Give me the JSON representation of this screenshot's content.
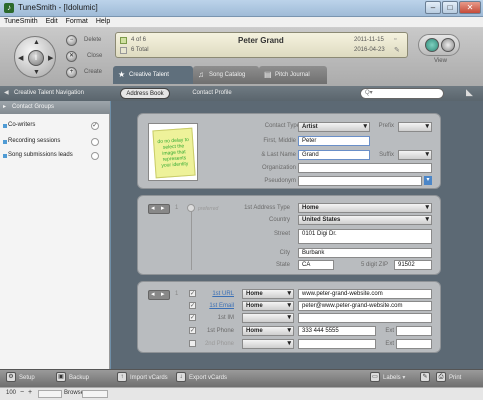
{
  "window": {
    "title": "TuneSmith - [Idolumic]",
    "minimize": "–",
    "maximize": "□",
    "close": "✕"
  },
  "menu": [
    "TuneSmith",
    "Edit",
    "Format",
    "Help"
  ],
  "controls": {
    "delete": "Delete",
    "close": "Close",
    "create": "Create",
    "view": "View"
  },
  "lcd": {
    "count": "4 of 6",
    "total": "6 Total",
    "name": "Peter Grand",
    "date1": "2011-11-15",
    "date2": "2016-04-23"
  },
  "tabs": [
    "Creative Talent",
    "Song Catalog",
    "Pitch Journal"
  ],
  "nav": {
    "title": "Creative Talent Navigation",
    "address_book": "Address Book",
    "contact_profile": "Contact Profile",
    "search_placeholder": "Q▾"
  },
  "sidebar": {
    "header": "Contact Groups",
    "items": [
      {
        "label": "Co-writers",
        "checked": true
      },
      {
        "label": "Recording sessions",
        "checked": false
      },
      {
        "label": "Song submissions leads",
        "checked": false
      }
    ]
  },
  "profile": {
    "sticky_note": "do no delay to select the image that represents your identity",
    "contact_type_label": "Contact Type",
    "contact_type": "Artist",
    "prefix_label": "Prefix",
    "first_label": "First, Middle",
    "first": "Peter",
    "last_label": "& Last Name",
    "last": "Grand",
    "suffix_label": "Suffix",
    "org_label": "Organization",
    "org": "",
    "pseudo_label": "Pseudonym",
    "pseudo": ""
  },
  "address": {
    "page": "1",
    "preferred": "preferred",
    "type_label": "1st Address Type",
    "type": "Home",
    "country_label": "Country",
    "country": "United States",
    "street_label": "Street",
    "street": "0101 Digi Dr.",
    "city_label": "City",
    "city": "Burbank",
    "state_label": "State",
    "state": "CA",
    "zip_label": "5 digit ZIP",
    "zip": "91502"
  },
  "contact": {
    "page": "1",
    "url_label": "1st URL",
    "url_type": "Home",
    "url": "www.peter-grand-website.com",
    "email_label": "1st Email",
    "email_type": "Home",
    "email": "peter@www.peter-grand-website.com",
    "im_label": "1st IM",
    "im": "",
    "phone1_label": "1st Phone",
    "phone1_type": "Home",
    "phone1": "333 444 5555",
    "ext_label": "Ext",
    "phone2_label": "2nd Phone",
    "phone2": ""
  },
  "bottom": {
    "setup": "Setup",
    "backup": "Backup",
    "import": "Import vCards",
    "export": "Export vCards",
    "labels": "Labels",
    "print": "Print"
  },
  "status": {
    "zoom": "100",
    "mode": "Browse"
  }
}
